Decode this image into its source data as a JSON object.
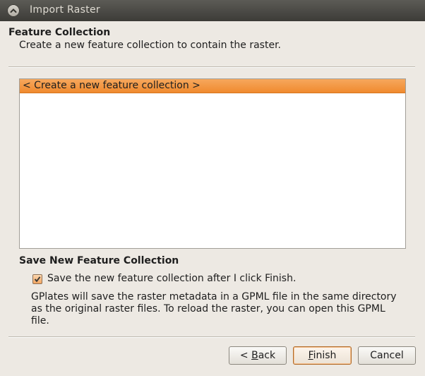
{
  "window": {
    "title": "Import Raster"
  },
  "page": {
    "title": "Feature Collection",
    "subtitle": "Create a new feature collection to contain the raster."
  },
  "collections": {
    "items": [
      {
        "label": "< Create a new feature collection >",
        "selected": true
      }
    ]
  },
  "save": {
    "title": "Save New Feature Collection",
    "checkbox_label": "Save the new feature collection after I click Finish.",
    "checked": true,
    "info": "GPlates will save the raster metadata in a GPML file in the same directory as the original raster files. To reload the raster, you can open this GPML file."
  },
  "buttons": {
    "back": {
      "prefix": "< ",
      "mnemonic": "B",
      "rest": "ack"
    },
    "finish": {
      "mnemonic": "F",
      "rest": "inish"
    },
    "cancel": "Cancel"
  },
  "colors": {
    "selection": "#f08a2e",
    "titlebar": "#3c3b37",
    "background": "#ede9e3"
  }
}
